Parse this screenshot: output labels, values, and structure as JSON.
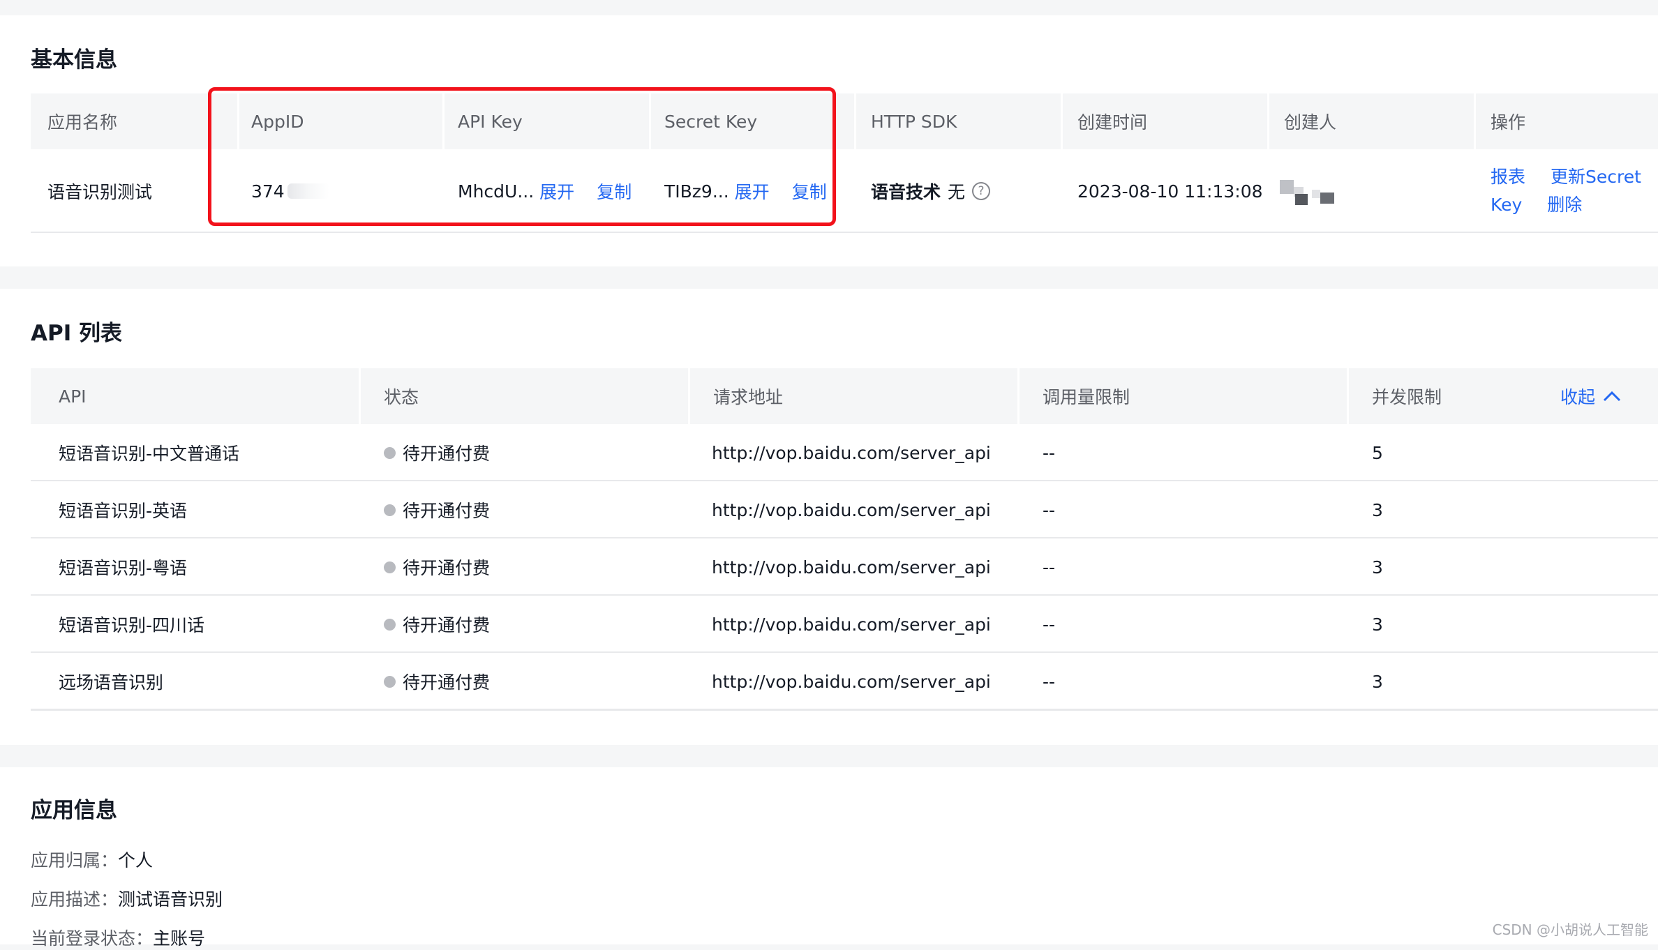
{
  "basic": {
    "title": "基本信息",
    "headers": [
      "应用名称",
      "AppID",
      "API Key",
      "Secret Key",
      "HTTP SDK",
      "创建时间",
      "创建人",
      "操作"
    ],
    "row": {
      "app_name": "语音识别测试",
      "app_id": "374",
      "api_key": "MhcdU...",
      "api_key_expand": "展开",
      "api_key_copy": "复制",
      "secret_key": "TIBz9...",
      "secret_key_expand": "展开",
      "secret_key_copy": "复制",
      "sdk_label": "语音技术",
      "sdk_value": "无",
      "created_at": "2023-08-10 11:13:08",
      "actions": [
        "报表",
        "更新Secret",
        "Key",
        "删除"
      ]
    }
  },
  "api_list": {
    "title": "API 列表",
    "headers": [
      "API",
      "状态",
      "请求地址",
      "调用量限制",
      "并发限制"
    ],
    "collapse_label": "收起",
    "rows": [
      {
        "api": "短语音识别-中文普通话",
        "status": "待开通付费",
        "url": "http://vop.baidu.com/server_api",
        "limit": "--",
        "concurrency": "5"
      },
      {
        "api": "短语音识别-英语",
        "status": "待开通付费",
        "url": "http://vop.baidu.com/server_api",
        "limit": "--",
        "concurrency": "3"
      },
      {
        "api": "短语音识别-粤语",
        "status": "待开通付费",
        "url": "http://vop.baidu.com/server_api",
        "limit": "--",
        "concurrency": "3"
      },
      {
        "api": "短语音识别-四川话",
        "status": "待开通付费",
        "url": "http://vop.baidu.com/server_api",
        "limit": "--",
        "concurrency": "3"
      },
      {
        "api": "远场语音识别",
        "status": "待开通付费",
        "url": "http://vop.baidu.com/server_api",
        "limit": "--",
        "concurrency": "3"
      }
    ]
  },
  "app_info": {
    "title": "应用信息",
    "owner_key": "应用归属：",
    "owner_value": "个人",
    "desc_key": "应用描述：",
    "desc_value": "测试语音识别",
    "login_key": "当前登录状态：",
    "login_value": "主账号"
  },
  "watermark": "CSDN @小胡说人工智能",
  "colors": {
    "accent": "#2468f2",
    "highlight_box": "#f2121b",
    "status_dot": "#b8babf",
    "page_bg": "#f5f6f7"
  }
}
